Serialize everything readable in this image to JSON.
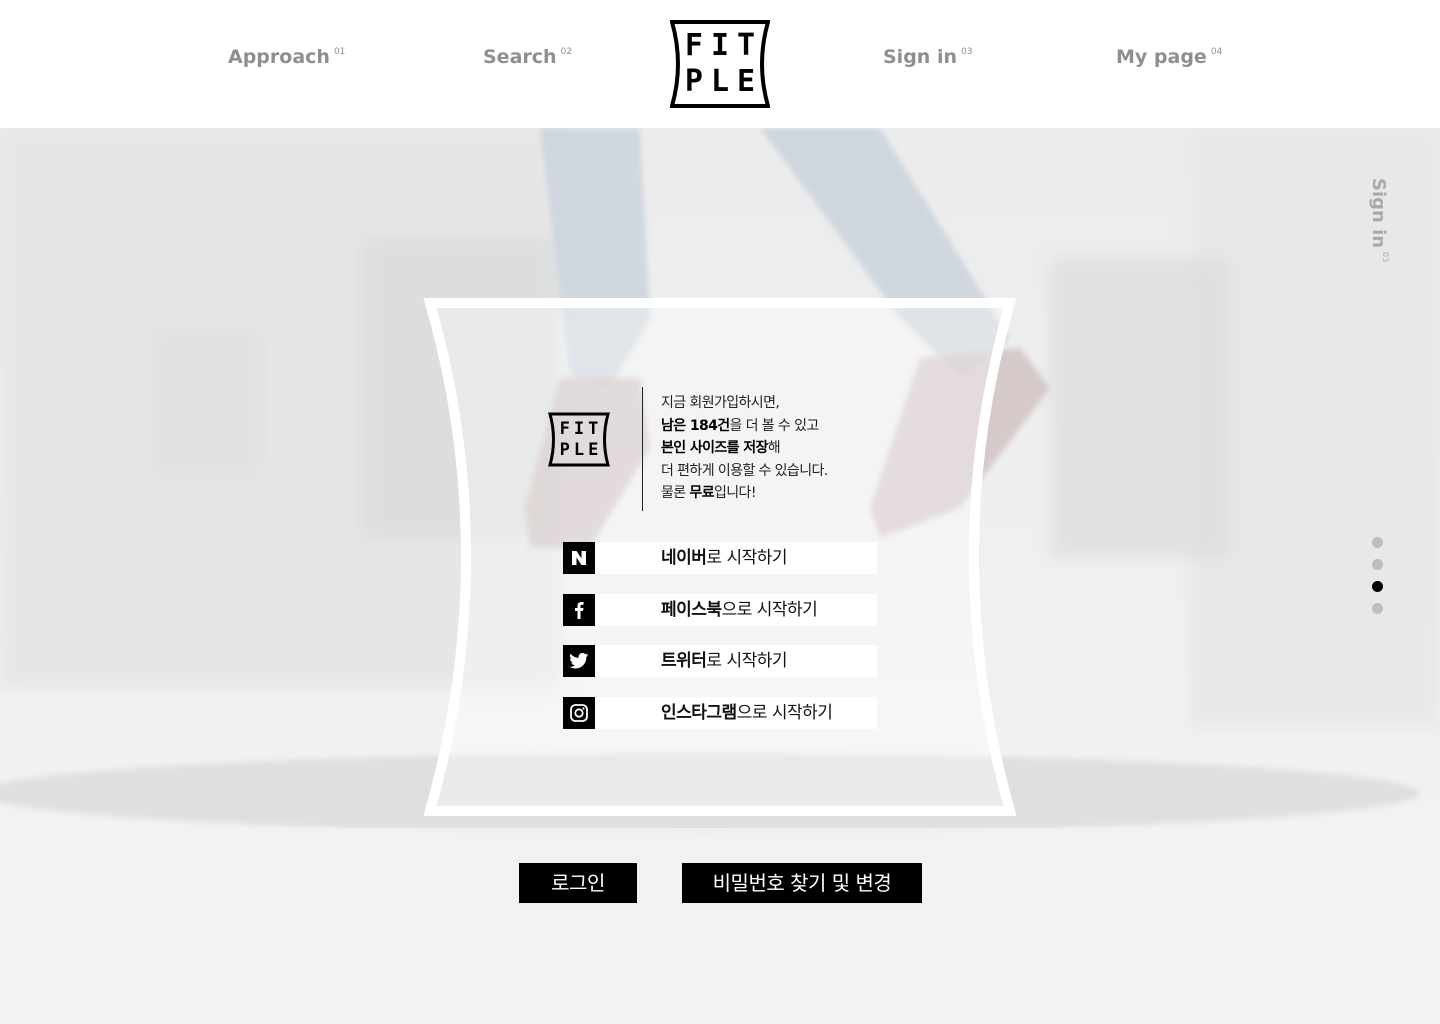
{
  "header": {
    "nav_left": [
      {
        "label": "Approach",
        "num": "01"
      },
      {
        "label": "Search",
        "num": "02"
      }
    ],
    "nav_right": [
      {
        "label": "Sign in",
        "num": "03"
      },
      {
        "label": "My page",
        "num": "04"
      }
    ],
    "logo": {
      "line1": "FIT",
      "line2": "PLE"
    }
  },
  "side": {
    "label": "Sign in",
    "num": "03",
    "active_dot": 3
  },
  "card": {
    "logo": {
      "line1": "FIT",
      "line2": "PLE"
    },
    "intro": {
      "line1": "지금 회원가입하시면,",
      "line2_bold": "남은 184건",
      "line2_rest": "을 더 볼 수 있고",
      "line3_bold": "본인 사이즈를 저장",
      "line3_rest": "해",
      "line4": "더 편하게 이용할 수 있습니다.",
      "line5_pre": "물론 ",
      "line5_bold": "무료",
      "line5_rest": "입니다!"
    },
    "sns": [
      {
        "brand": "네이버",
        "rest": "로 시작하기",
        "icon": "naver-icon"
      },
      {
        "brand": "페이스북",
        "rest": "으로 시작하기",
        "icon": "facebook-icon"
      },
      {
        "brand": "트위터",
        "rest": "로 시작하기",
        "icon": "twitter-icon"
      },
      {
        "brand": "인스타그램",
        "rest": "으로 시작하기",
        "icon": "instagram-icon"
      }
    ]
  },
  "buttons": {
    "login": "로그인",
    "find_password": "비밀번호 찾기 및 변경"
  }
}
